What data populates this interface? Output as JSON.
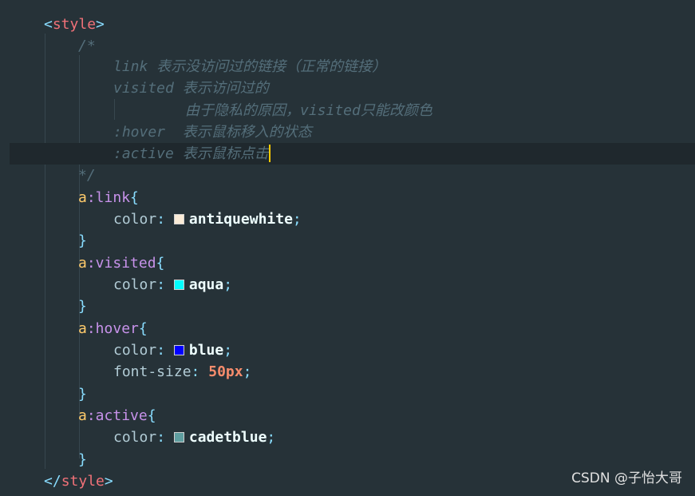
{
  "code": {
    "style_open": {
      "lt": "<",
      "tag": "style",
      "gt": ">"
    },
    "comment": {
      "open": "/*",
      "link": "link 表示没访问过的链接（正常的链接）",
      "visited": "visited 表示访问过的",
      "visited_note": "由于隐私的原因，visited只能改颜色",
      "hover": ":hover  表示鼠标移入的状态",
      "active": ":active 表示鼠标点击",
      "close": "*/"
    },
    "rules": [
      {
        "el": "a",
        "pseudo": ":link",
        "open": "{",
        "prop": "color",
        "colon": ":",
        "value": "antiquewhite",
        "semi": ";",
        "swatch": "#faebd7",
        "close": "}"
      },
      {
        "el": "a",
        "pseudo": ":visited",
        "open": "{",
        "prop": "color",
        "colon": ":",
        "value": "aqua",
        "semi": ";",
        "swatch": "#00ffff",
        "close": "}"
      },
      {
        "el": "a",
        "pseudo": ":hover",
        "open": "{",
        "prop": "color",
        "colon": ":",
        "value": "blue",
        "semi": ";",
        "swatch": "#0000ff",
        "prop2": "font-size",
        "colon2": ":",
        "value2": "50px",
        "semi2": ";",
        "close": "}"
      },
      {
        "el": "a",
        "pseudo": ":active",
        "open": "{",
        "prop": "color",
        "colon": ":",
        "value": "cadetblue",
        "semi": ";",
        "swatch": "#5f9ea0",
        "close": "}"
      }
    ],
    "style_close": {
      "lt": "</",
      "tag": "style",
      "gt": ">"
    }
  },
  "theme": {
    "background": "#263238",
    "active_line": "#1f282d",
    "caret": "#ffcc00"
  },
  "watermark": "CSDN @子怡大哥"
}
